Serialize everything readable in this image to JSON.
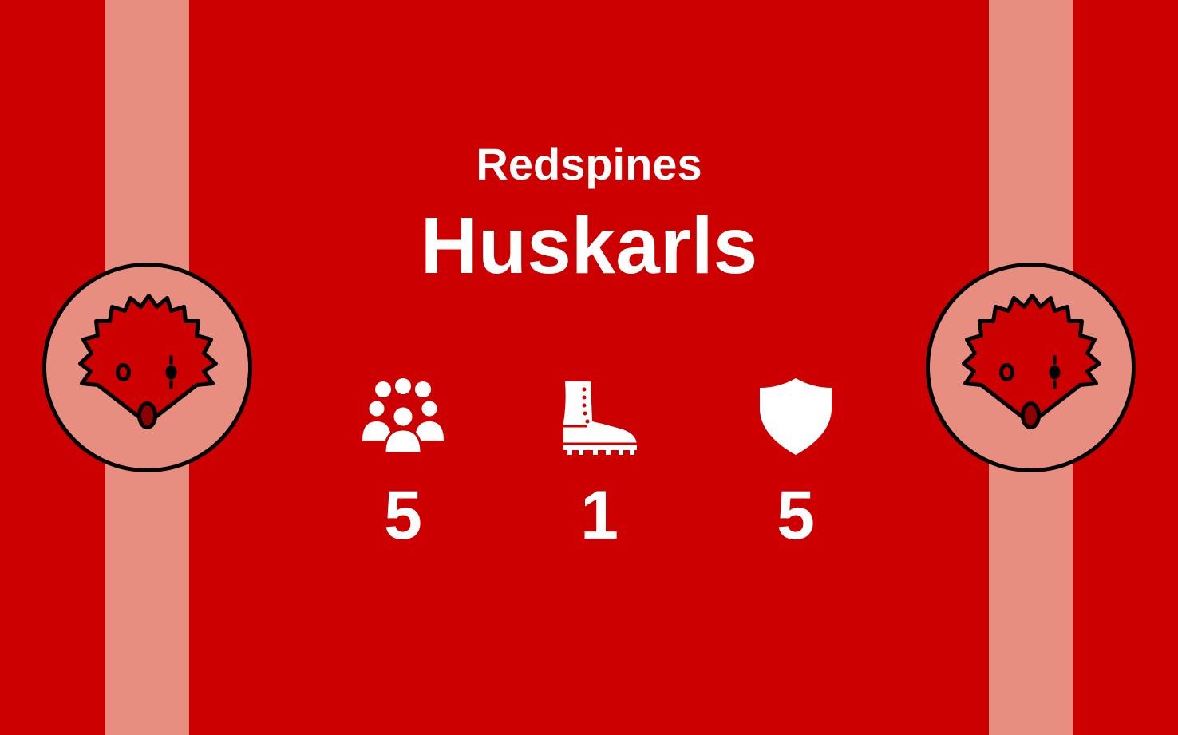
{
  "card": {
    "faction": "Redspines",
    "unit_name": "Huskarls",
    "emblem_icon": "hedgehog-icon",
    "colors": {
      "background": "#cc0000",
      "stripe": "#e88e80",
      "text": "#ffffff"
    },
    "stats": [
      {
        "icon": "group-icon",
        "value": "5"
      },
      {
        "icon": "boot-icon",
        "value": "1"
      },
      {
        "icon": "shield-icon",
        "value": "5"
      }
    ]
  }
}
